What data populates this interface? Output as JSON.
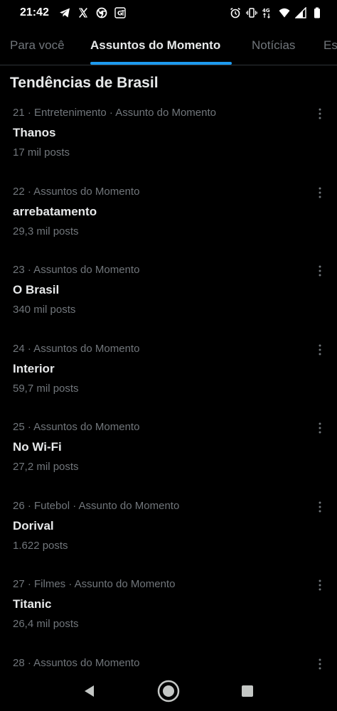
{
  "status_bar": {
    "time": "21:42",
    "left_icons": [
      "telegram-icon",
      "x-logo-icon",
      "chrome-icon",
      "translate-icon"
    ],
    "right_icons": [
      "alarm-icon",
      "vibrate-icon",
      "4g-icon",
      "wifi-icon",
      "signal-icon",
      "battery-icon"
    ]
  },
  "tabs": [
    {
      "label": "Para você",
      "active": false
    },
    {
      "label": "Assuntos do Momento",
      "active": true
    },
    {
      "label": "Notícias",
      "active": false
    },
    {
      "label": "Es",
      "active": false
    }
  ],
  "section_title": "Tendências de Brasil",
  "trends": [
    {
      "meta": "21 · Entretenimento · Assunto do Momento",
      "name": "Thanos",
      "count": "17 mil posts"
    },
    {
      "meta": "22 · Assuntos do Momento",
      "name": "arrebatamento",
      "count": "29,3 mil posts"
    },
    {
      "meta": "23 · Assuntos do Momento",
      "name": "O Brasil",
      "count": "340 mil posts"
    },
    {
      "meta": "24 · Assuntos do Momento",
      "name": "Interior",
      "count": "59,7 mil posts"
    },
    {
      "meta": "25 · Assuntos do Momento",
      "name": "No Wi-Fi",
      "count": "27,2 mil posts"
    },
    {
      "meta": "26 · Futebol · Assunto do Momento",
      "name": "Dorival",
      "count": "1.622 posts"
    },
    {
      "meta": "27 · Filmes · Assunto do Momento",
      "name": "Titanic",
      "count": "26,4 mil posts"
    },
    {
      "meta": "28 · Assuntos do Momento",
      "name": "",
      "count": ""
    }
  ],
  "colors": {
    "background": "#000000",
    "primary_text": "#e7e9ea",
    "secondary_text": "#71767b",
    "accent": "#1d9bf0",
    "divider": "#2f3336"
  },
  "navbar": {
    "icons": [
      "back-icon",
      "home-icon",
      "recents-icon"
    ]
  }
}
